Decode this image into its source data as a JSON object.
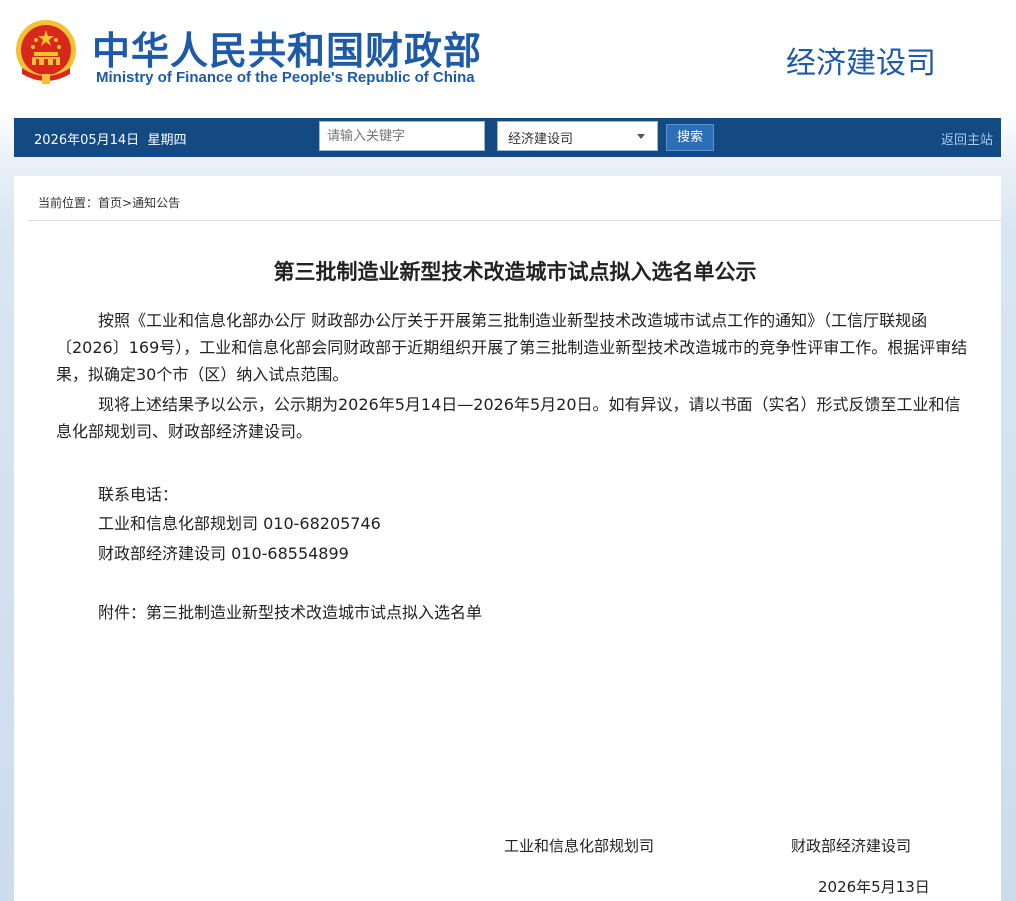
{
  "header": {
    "site_title_cn": "中华人民共和国财政部",
    "site_title_en": "Ministry of Finance of the People's Republic of China",
    "department": "经济建设司"
  },
  "navbar": {
    "date": "2026年05月14日",
    "weekday": "星期四",
    "search_placeholder": "请输入关键字",
    "select_value": "经济建设司",
    "search_button": "搜索",
    "home_link": "返回主站"
  },
  "breadcrumb": {
    "prefix": "当前位置：",
    "home": "首页",
    "separator": ">",
    "section": "通知公告"
  },
  "article": {
    "title": "第三批制造业新型技术改造城市试点拟入选名单公示",
    "paragraph1": "按照《工业和信息化部办公厅 财政部办公厅关于开展第三批制造业新型技术改造城市试点工作的通知》（工信厅联规函〔2026〕169号），工业和信息化部会同财政部于近期组织开展了第三批制造业新型技术改造城市的竞争性评审工作。根据评审结果，拟确定30个市（区）纳入试点范围。",
    "paragraph2": "现将上述结果予以公示，公示期为2026年5月14日—2026年5月20日。如有异议，请以书面（实名）形式反馈至工业和信息化部规划司、财政部经济建设司。",
    "contact_label": "联系电话：",
    "contact1": "工业和信息化部规划司 010-68205746",
    "contact2": "财政部经济建设司 010-68554899",
    "attachment": "附件：第三批制造业新型技术改造城市试点拟入选名单",
    "signer1": "工业和信息化部规划司",
    "signer2": "财政部经济建设司",
    "sign_date": "2026年5月13日"
  },
  "colors": {
    "brand_blue": "#1d5aa8",
    "navbar": "#134a82",
    "emblem_red": "#d8281e",
    "emblem_gold": "#f2c230"
  }
}
